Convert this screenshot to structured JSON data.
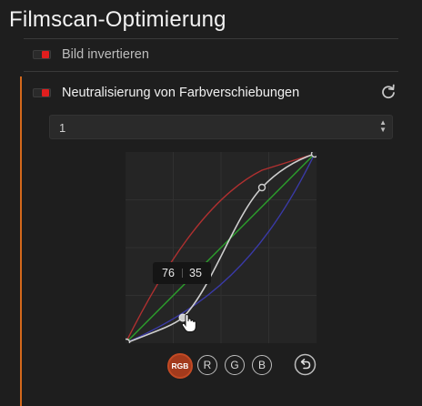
{
  "panel": {
    "title": "Filmscan-Optimierung",
    "invert": {
      "label": "Bild invertieren",
      "enabled": true
    },
    "neutralize": {
      "label": "Neutralisierung von Farbverschiebungen",
      "enabled": true
    },
    "select": {
      "value": "1"
    },
    "tooltip": {
      "input": "76",
      "output": "35"
    },
    "channels": {
      "rgb": "RGB",
      "r": "R",
      "g": "G",
      "b": "B",
      "active": "RGB"
    },
    "icons": {
      "reset": "reset-icon",
      "undo": "undo-icon",
      "select_arrows": "updown-arrows-icon",
      "cursor": "hand-cursor-icon"
    },
    "colors": {
      "accent": "#d4681c",
      "toggle_on": "#e01e1e",
      "red_curve": "#b03030",
      "green_curve": "#2ca02c",
      "blue_curve": "#3a3aa8",
      "rgb_curve": "#cfcfcf"
    }
  }
}
